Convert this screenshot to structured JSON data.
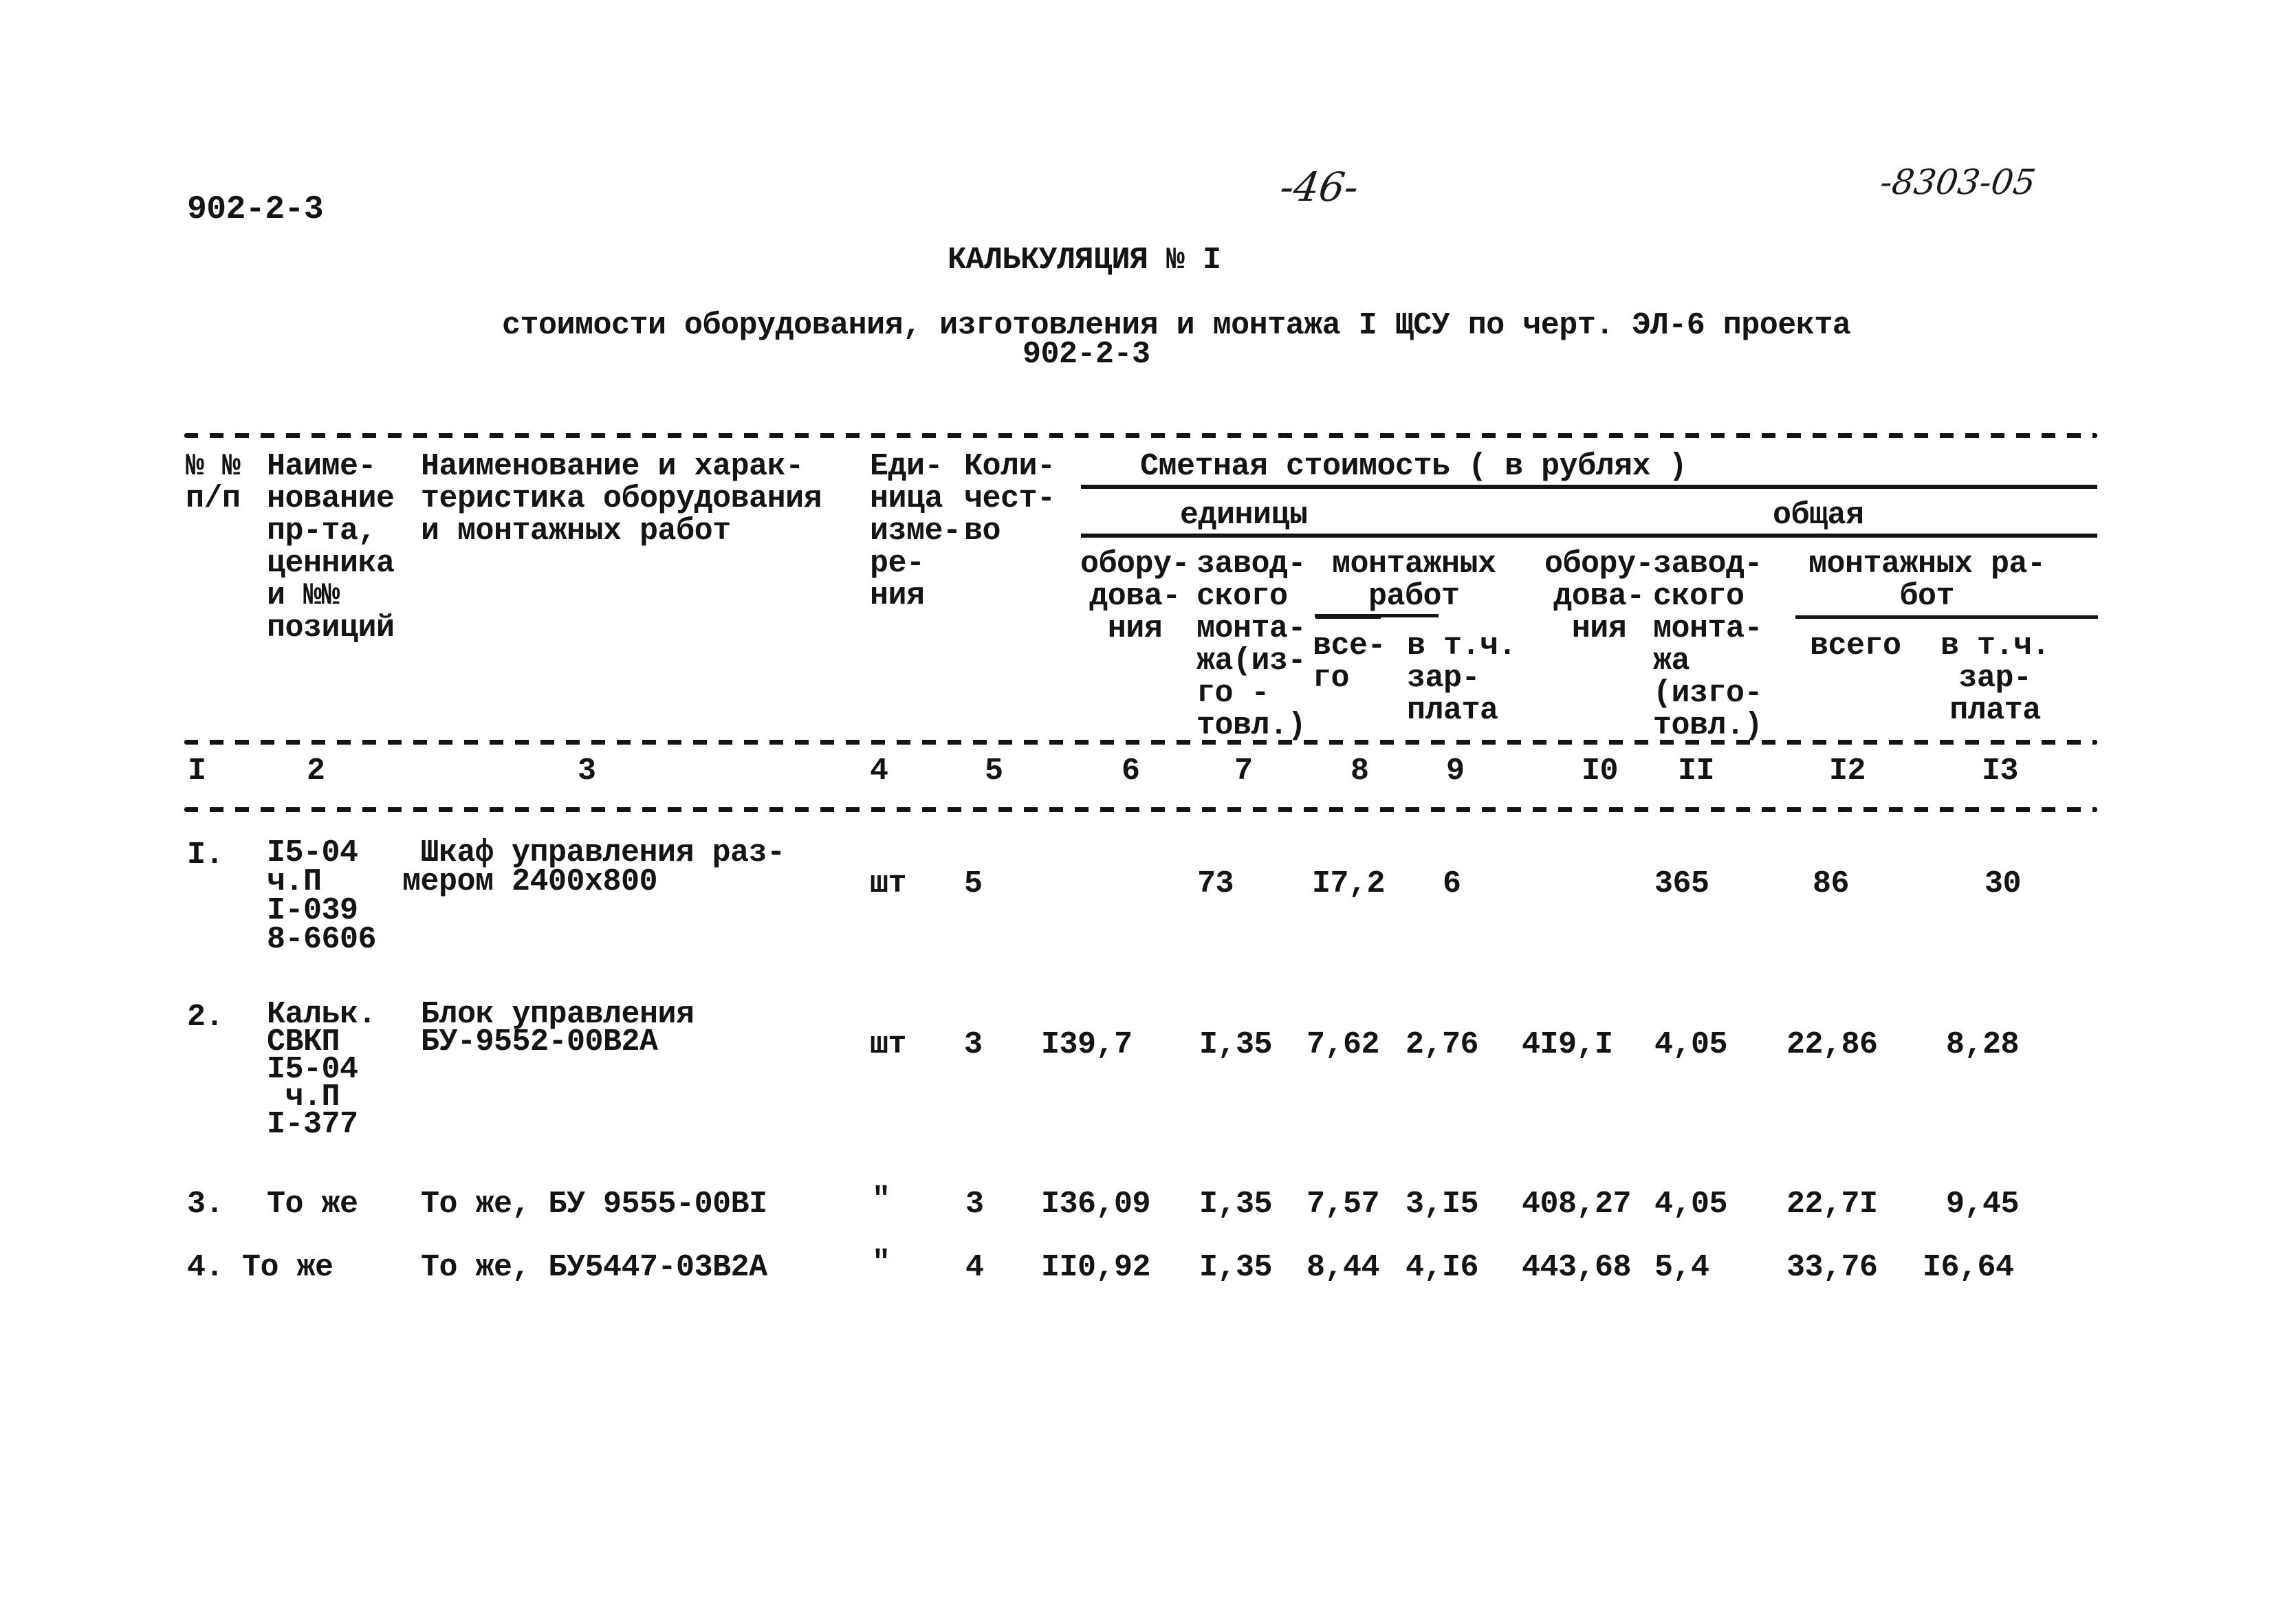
{
  "page": {
    "doc_code_left": "902-2-3",
    "page_number": "-46-",
    "inventory_number": "-8303-05"
  },
  "title": {
    "heading": "КАЛЬКУЛЯЦИЯ № I",
    "subtitle_line1": "стоимости оборудования, изготовления и монтажа I ЩСУ по черт. ЭЛ-6 проекта",
    "subtitle_line2": "902-2-3"
  },
  "table": {
    "headers": {
      "col1": "№ №\nп/п",
      "col2": "Наиме-\nнование\nпр-та,\nценника\nи №№\nпозиций",
      "col3": "Наименование и харак-\nтеристика оборудования\nи монтажных работ",
      "col4": "Еди-\nница\nизме-\nре-\nния",
      "col5": "Коли-\nчест-\nво",
      "group_cost": "Сметная стоимость ( в рублях )",
      "group_unit": "единицы",
      "group_total": "общая",
      "unit_equipment": "обору-\nдова-\nния",
      "unit_factory": "завод-\nского\nмонта-\nжа(из-\nго -\nтовл.)",
      "unit_install_group": "монтажных\nработ",
      "unit_install_total": "все-\nго",
      "unit_install_wages": "в т.ч.\nзар-\nплата",
      "total_equipment": "обору-\nдова-\nния",
      "total_factory": "завод-\nского\nмонта-\nжа\n(изго-\nтовл.)",
      "total_install_group": "монтажных ра-\nбот",
      "total_install_total": "всего",
      "total_install_wages": "в т.ч.\nзар-\nплата"
    },
    "column_numbers": [
      "I",
      "2",
      "3",
      "4",
      "5",
      "6",
      "7",
      "8",
      "9",
      "I0",
      "II",
      "I2",
      "I3"
    ],
    "rows": [
      {
        "num": "I.",
        "ref": "I5-04\nч.П\nI-039\n8-6606",
        "name": " Шкаф управления раз-\nмером 2400х800",
        "unit": "шт",
        "qty": "5",
        "u_equipment": "",
        "u_factory": "73",
        "u_install": "I7,2",
        "u_wages": "6",
        "t_equipment": "",
        "t_factory": "365",
        "t_install": "86",
        "t_wages": "30"
      },
      {
        "num": "2.",
        "ref": "Кальк.\nСВКП\nI5-04\n ч.П\nI-377",
        "name": "Блок управления\nБУ-9552-00В2А",
        "unit": "шт",
        "qty": "3",
        "u_equipment": "I39,7",
        "u_factory": "I,35",
        "u_install": "7,62",
        "u_wages": "2,76",
        "t_equipment": "4I9,I",
        "t_factory": "4,05",
        "t_install": "22,86",
        "t_wages": "8,28"
      },
      {
        "num": "3.",
        "ref": "То же",
        "name": "То же, БУ 9555-00ВI",
        "unit": "\"",
        "qty": "3",
        "u_equipment": "I36,09",
        "u_factory": "I,35",
        "u_install": "7,57",
        "u_wages": "3,I5",
        "t_equipment": "408,27",
        "t_factory": "4,05",
        "t_install": "22,7I",
        "t_wages": "9,45"
      },
      {
        "num": "4.",
        "ref": "То же",
        "name": "То же, БУ5447-03В2А",
        "unit": "\"",
        "qty": "4",
        "u_equipment": "II0,92",
        "u_factory": "I,35",
        "u_install": "8,44",
        "u_wages": "4,I6",
        "t_equipment": "443,68",
        "t_factory": "5,4",
        "t_install": "33,76",
        "t_wages": "I6,64"
      }
    ]
  }
}
